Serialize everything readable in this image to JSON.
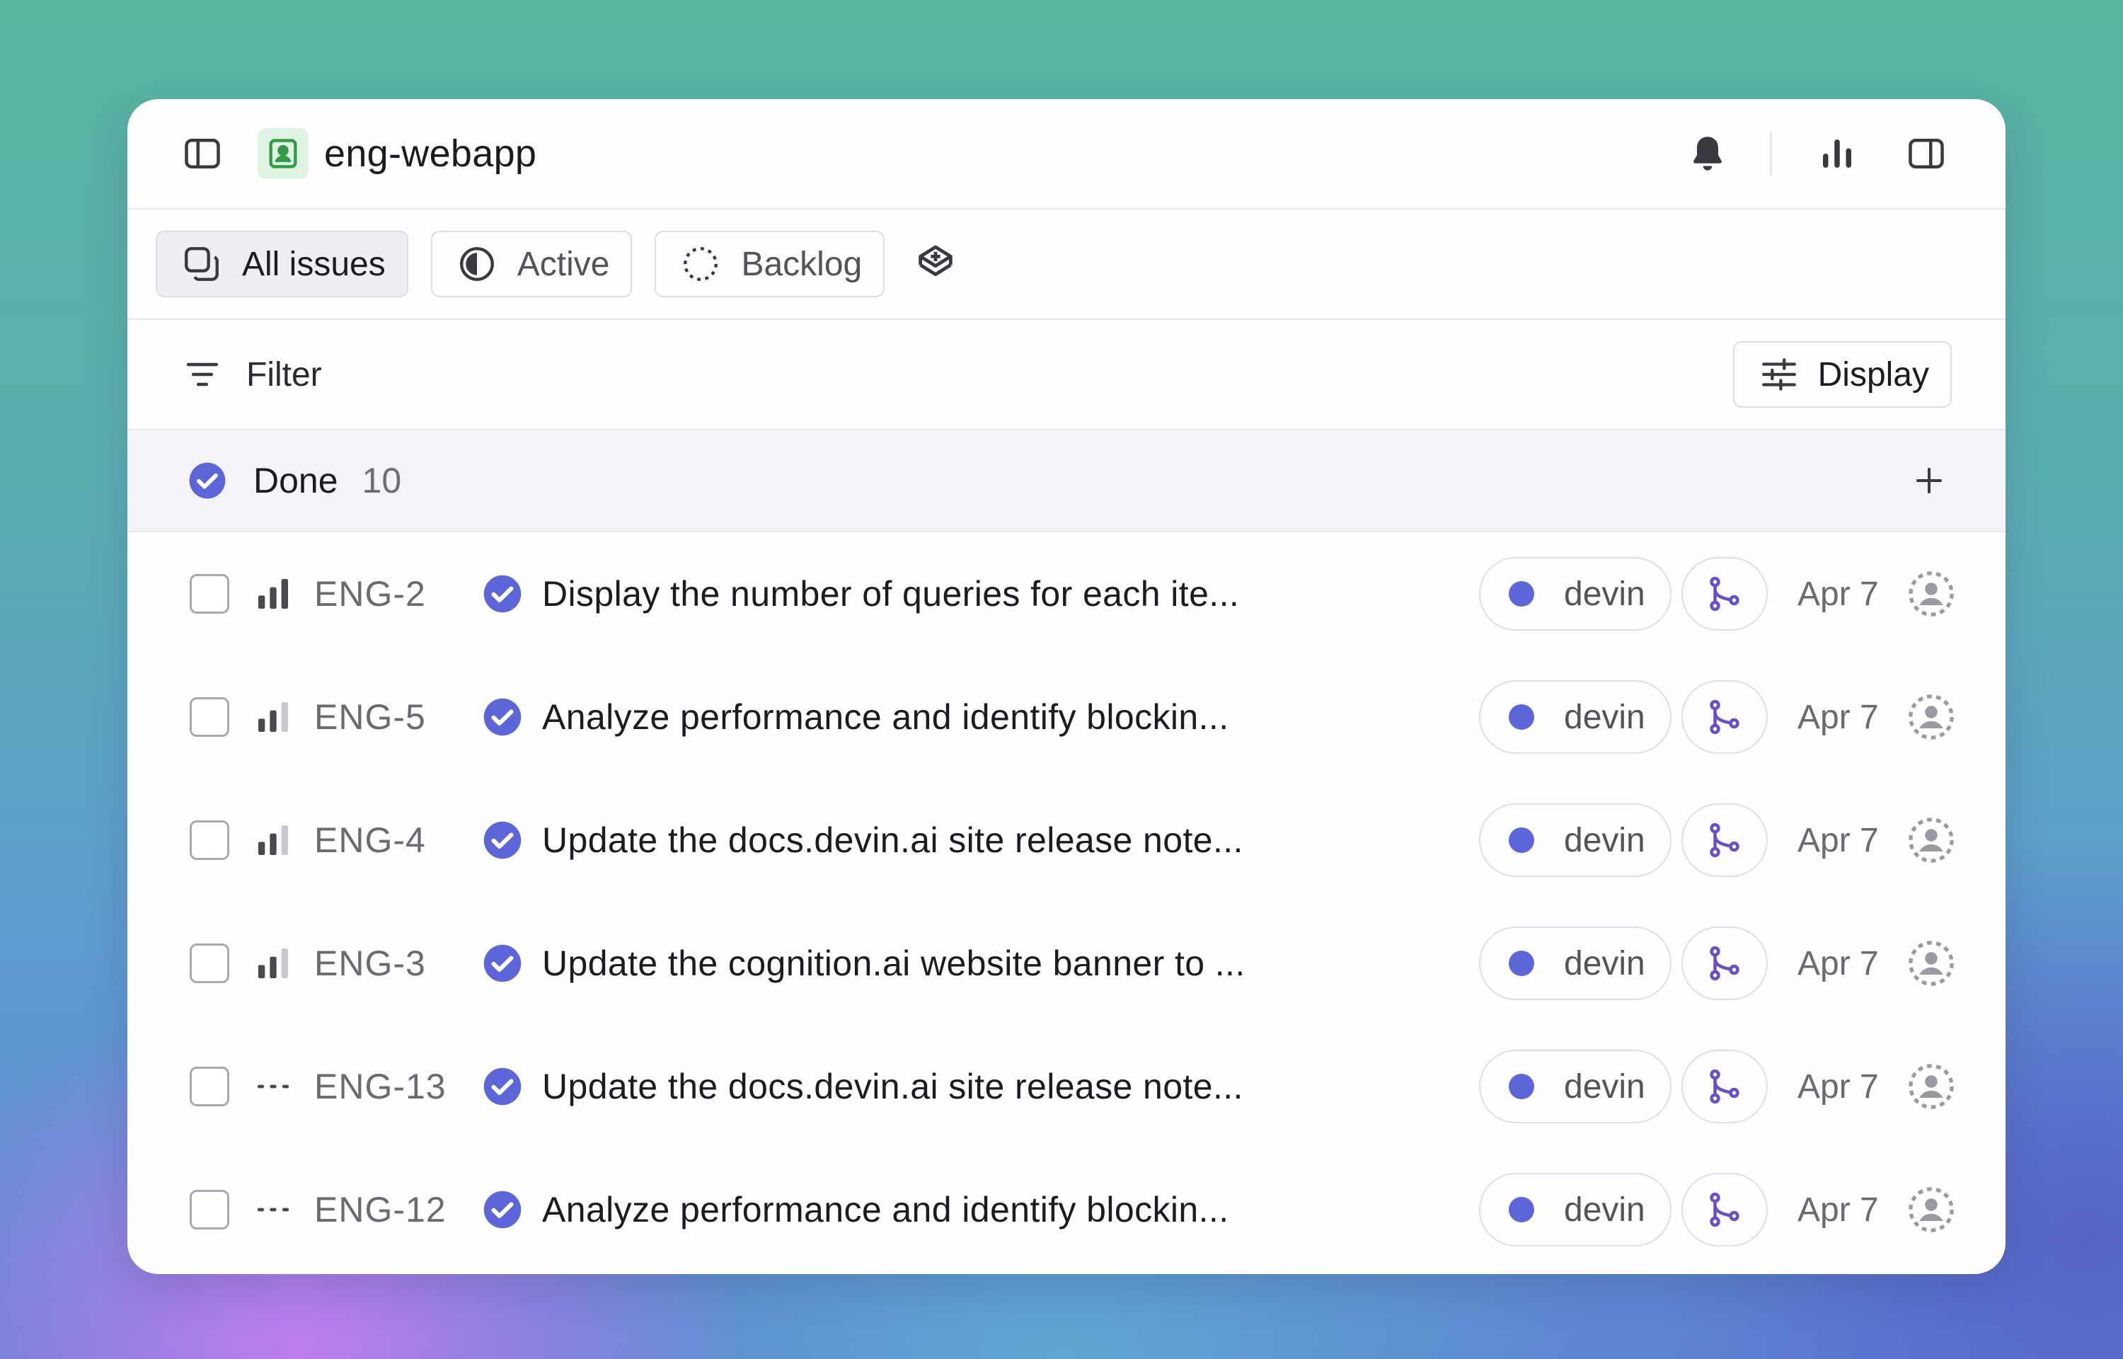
{
  "header": {
    "team_name": "eng-webapp",
    "team_icon_color": "#2e9a4a"
  },
  "tabs": [
    {
      "label": "All issues",
      "icon": "issues-icon",
      "selected": true
    },
    {
      "label": "Active",
      "icon": "half-circle-icon",
      "selected": false
    },
    {
      "label": "Backlog",
      "icon": "dashed-circle-icon",
      "selected": false
    }
  ],
  "toolbar": {
    "filter_label": "Filter",
    "display_label": "Display"
  },
  "group": {
    "title": "Done",
    "count": "10",
    "status_color": "#5d66d8"
  },
  "issues": [
    {
      "id": "ENG-2",
      "priority": "high",
      "title": "Display the number of queries for each ite...",
      "label": "devin",
      "date": "Apr 7"
    },
    {
      "id": "ENG-5",
      "priority": "medium",
      "title": "Analyze performance and identify blockin...",
      "label": "devin",
      "date": "Apr 7"
    },
    {
      "id": "ENG-4",
      "priority": "medium",
      "title": "Update the docs.devin.ai site release note...",
      "label": "devin",
      "date": "Apr 7"
    },
    {
      "id": "ENG-3",
      "priority": "medium",
      "title": "Update the cognition.ai website banner to ...",
      "label": "devin",
      "date": "Apr 7"
    },
    {
      "id": "ENG-13",
      "priority": "none",
      "title": "Update the docs.devin.ai site release note...",
      "label": "devin",
      "date": "Apr 7"
    },
    {
      "id": "ENG-12",
      "priority": "none",
      "title": "Analyze performance and identify blockin...",
      "label": "devin",
      "date": "Apr 7"
    }
  ],
  "colors": {
    "accent": "#5d66d8",
    "branch": "#6b4fc8"
  }
}
